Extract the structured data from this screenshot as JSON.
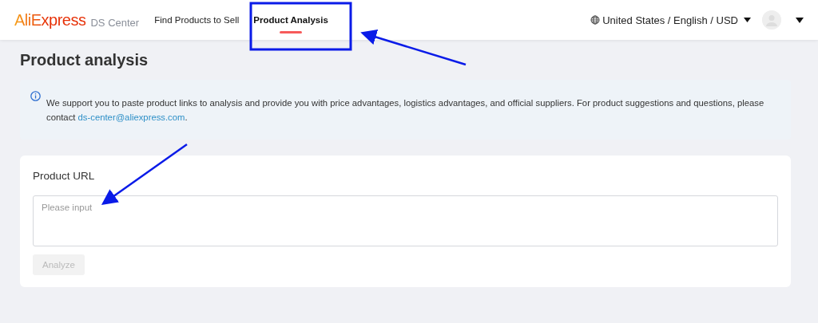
{
  "header": {
    "logo": "AliExpress",
    "logo_sub": "DS Center",
    "nav": [
      {
        "label": "Find Products to Sell",
        "selected": false
      },
      {
        "label": "Product Analysis",
        "selected": true
      }
    ],
    "locale": "United States / English / USD"
  },
  "page_title": "Product analysis",
  "notice": {
    "text": "We support you to paste product links to analysis and provide you with price advantages, logistics advantages, and official suppliers. For product suggestions and questions, please contact ",
    "link": "ds-center@aliexpress.com",
    "after": "."
  },
  "form": {
    "label": "Product URL",
    "placeholder": "Please input",
    "button": {
      "label": "Analyze",
      "disabled": true
    }
  }
}
